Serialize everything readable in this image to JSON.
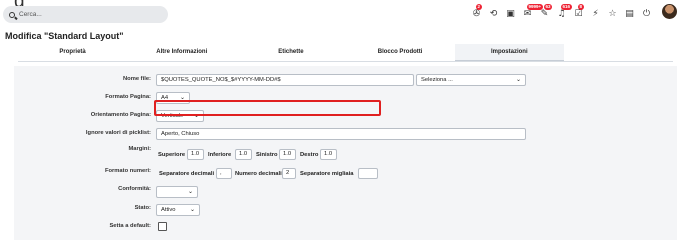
{
  "header": {
    "title_fragment": "g",
    "search_placeholder": "Cerca...",
    "icons": [
      {
        "name": "group-icon",
        "glyph": "✇",
        "badge": "2"
      },
      {
        "name": "history-icon",
        "glyph": "⟲",
        "badge": ""
      },
      {
        "name": "calendar-icon",
        "glyph": "▣",
        "badge": ""
      },
      {
        "name": "mail-icon",
        "glyph": "✉",
        "badge": "9999+"
      },
      {
        "name": "chat-icon",
        "glyph": "✎",
        "badge": "63"
      },
      {
        "name": "bell-icon",
        "glyph": "♫",
        "badge": "616"
      },
      {
        "name": "tasks-icon",
        "glyph": "☑",
        "badge": "8"
      },
      {
        "name": "bolt-icon",
        "glyph": "⚡",
        "badge": ""
      },
      {
        "name": "star-icon",
        "glyph": "☆",
        "badge": ""
      },
      {
        "name": "document-icon",
        "glyph": "▤",
        "badge": ""
      },
      {
        "name": "power-icon",
        "glyph": "⏻",
        "badge": ""
      }
    ]
  },
  "page_title": "Modifica \"Standard Layout\"",
  "tabs": [
    {
      "label": "Proprietà",
      "active": false
    },
    {
      "label": "Altre Informazioni",
      "active": false
    },
    {
      "label": "Etichette",
      "active": false
    },
    {
      "label": "Blocco Prodotti",
      "active": false
    },
    {
      "label": "Impostazioni",
      "active": true
    },
    {
      "label": "",
      "active": false
    }
  ],
  "form": {
    "nome_file": {
      "label": "Nome file:",
      "value": "$QUOTES_QUOTE_NO$_$#YYYY-MM-DD#$",
      "select_value": "Seleziona ..."
    },
    "formato_pagina": {
      "label": "Formato Pagina:",
      "value": "A4"
    },
    "orientamento": {
      "label": "Orientamento Pagina:",
      "value": "Verticale"
    },
    "ignora": {
      "label": "Ignore valori di picklist:",
      "value": "Aperto, Chiuso"
    },
    "margini": {
      "label": "Margini:",
      "superiore_label": "Superiore",
      "superiore": "1.0",
      "inferiore_label": "Inferiore",
      "inferiore": "1.0",
      "sinistro_label": "Sinistro",
      "sinistro": "1.0",
      "destro_label": "Destro",
      "destro": "1.0"
    },
    "formato_numeri": {
      "label": "Formato numeri:",
      "sep_decimali_label": "Separatore decimali",
      "sep_decimali": ",",
      "num_decimali_label": "Numero decimali",
      "num_decimali": "2",
      "sep_migliaia_label": "Separatore migliaia",
      "sep_migliaia": ""
    },
    "conformita": {
      "label": "Conformità:",
      "value": ""
    },
    "stato": {
      "label": "Stato:",
      "value": "Attivo"
    },
    "default": {
      "label": "Setta a default:",
      "checked": false
    }
  },
  "colors": {
    "highlight": "#e02020",
    "panel_bg": "#f4f5f7",
    "badge": "#e22233"
  }
}
